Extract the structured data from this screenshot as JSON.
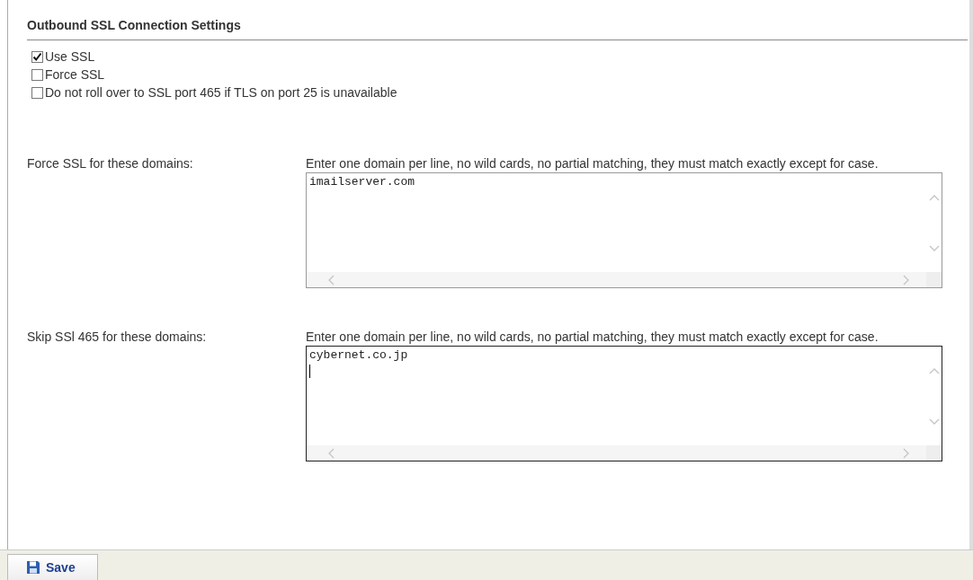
{
  "section": {
    "title": "Outbound SSL Connection Settings"
  },
  "options": [
    {
      "label": "Use SSL",
      "checked": true
    },
    {
      "label": "Force SSL",
      "checked": false
    },
    {
      "label": "Do not roll over to SSL port 465 if TLS on port 25 is unavailable",
      "checked": false
    }
  ],
  "domain_lists": [
    {
      "label": "Force SSL for these domains:",
      "hint": "Enter one domain per line, no wild cards, no partial matching, they must match exactly except for case.",
      "value": "imailserver.com",
      "focused": false
    },
    {
      "label": "Skip SSl 465 for these domains:",
      "hint": "Enter one domain per line, no wild cards, no partial matching, they must match exactly except for case.",
      "value": "cybernet.co.jp",
      "focused": true
    }
  ],
  "toolbar": {
    "buttons": [
      {
        "label": "Save"
      }
    ]
  }
}
